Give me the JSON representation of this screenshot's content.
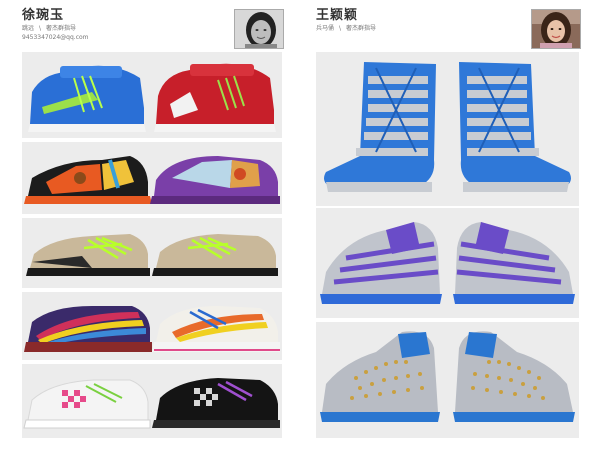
{
  "left_profile": {
    "name": "徐琬玉",
    "role": "跳远",
    "org": "奢杰群指导",
    "email": "9453347024@qq.com",
    "avatar": "woman-portrait-grayscale"
  },
  "right_profile": {
    "name": "王颖颖",
    "role": "兵马俑",
    "org": "奢杰群指导",
    "avatar": "woman-portrait-color"
  },
  "left_gallery": [
    {
      "name": "hightop-blue-red-strap-sneakers",
      "colors": [
        "#2a6fd6",
        "#c71f2a",
        "#9be04a"
      ]
    },
    {
      "name": "patchwork-orange-purple-sneakers",
      "colors": [
        "#e85a22",
        "#7a3fa8",
        "#f0c23a"
      ]
    },
    {
      "name": "lowtop-tan-lime-lace-sneakers",
      "colors": [
        "#c9b89a",
        "#1a1a1a",
        "#b8ff2a"
      ]
    },
    {
      "name": "rainbow-stripe-sneakers",
      "colors": [
        "#d0305a",
        "#3c8ad8",
        "#f0d020"
      ]
    },
    {
      "name": "white-black-checker-sneakers",
      "colors": [
        "#f4f4f4",
        "#141414",
        "#a050d0"
      ]
    }
  ],
  "right_gallery": [
    {
      "name": "silver-blue-cage-boots",
      "colors": [
        "#2f78d8",
        "#c8ccd2"
      ]
    },
    {
      "name": "silver-purple-strap-sneakers",
      "colors": [
        "#6a4cc8",
        "#c0c4cc"
      ]
    },
    {
      "name": "silver-blue-studded-hightops",
      "colors": [
        "#2a76d0",
        "#b8bcc4",
        "#c9a040"
      ]
    }
  ]
}
